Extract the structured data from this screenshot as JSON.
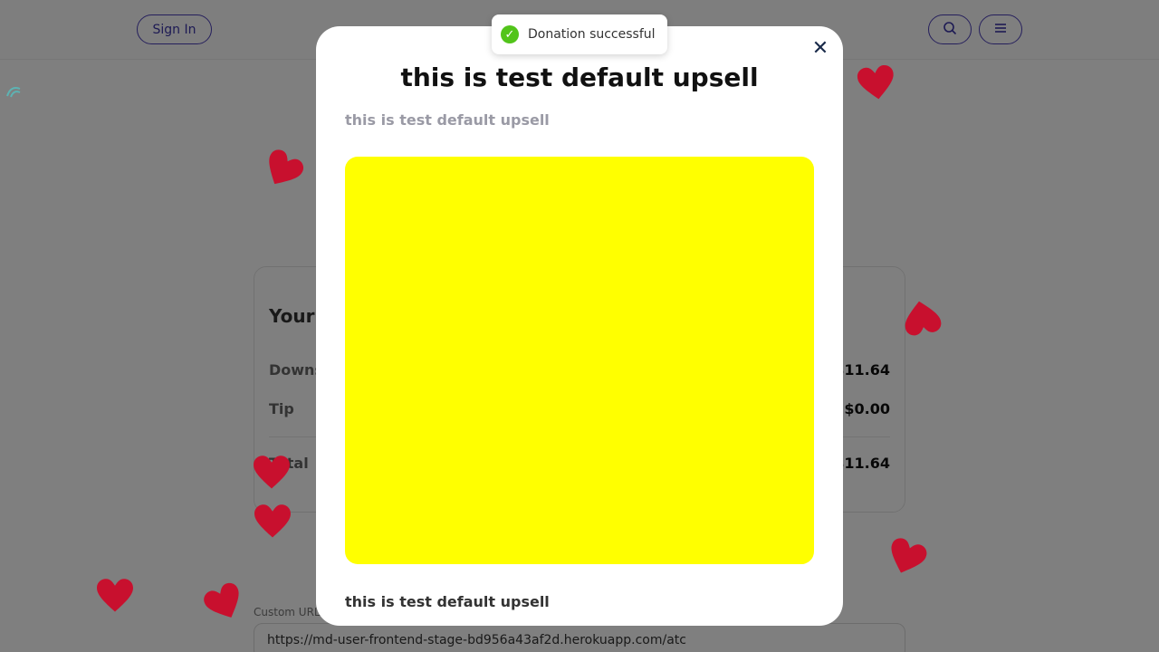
{
  "header": {
    "signin_label": "Sign In",
    "search_icon": "search-icon",
    "menu_icon": "hamburger-icon"
  },
  "summary": {
    "title": "Your o",
    "rows": [
      {
        "label": "Downs",
        "value": "$11.64"
      },
      {
        "label": "Tip",
        "value": "$0.00"
      },
      {
        "label": "Total",
        "value": "$11.64"
      }
    ]
  },
  "custom_url": {
    "label": "Custom URL",
    "value": "https://md-user-frontend-stage-bd956a43af2d.herokuapp.com/atc"
  },
  "toast": {
    "icon": "check-circle-icon",
    "message": "Donation successful",
    "color": "#52c41a"
  },
  "modal": {
    "close_icon": "close-icon",
    "title": "this is test default upsell",
    "subtitle": "this is test default upsell",
    "image_color": "#ffff00",
    "caption": "this is test default upsell"
  },
  "decor": {
    "heart_color": "#c8102e",
    "heart_icon": "heart-icon"
  }
}
